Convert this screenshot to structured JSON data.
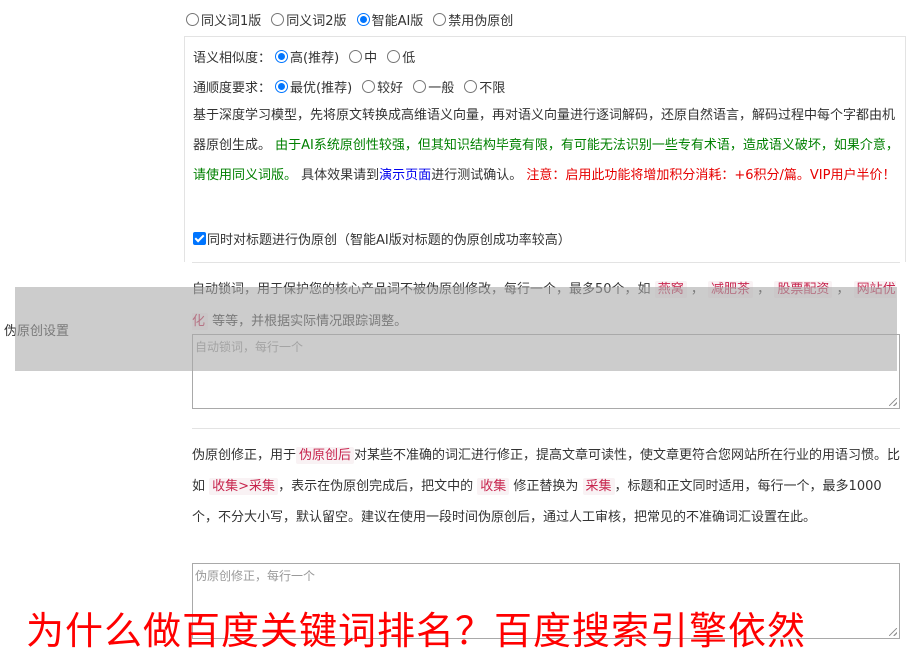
{
  "mode": {
    "options": [
      "同义词1版",
      "同义词2版",
      "智能AI版",
      "禁用伪原创"
    ],
    "selected": 2
  },
  "similarity": {
    "label": "语义相似度：",
    "options": [
      "高(推荐)",
      "中",
      "低"
    ]
  },
  "fluency": {
    "label": "通顺度要求：",
    "options": [
      "最优(推荐)",
      "较好",
      "一般",
      "不限"
    ]
  },
  "description": {
    "part1": "基于深度学习模型，先将原文转换成高维语义向量，再对语义向量进行逐词解码，还原自然语言，解码过程中每个字都由机器原创生成。",
    "part2_green": "由于AI系统原创性较强，但其知识结构毕竟有限，有可能无法识别一些专有术语，造成语义破坏，如果介意，请使用同义词版。",
    "part3_pre": "具体效果请到",
    "demo_link": "演示页面",
    "part3_post": "进行测试确认。",
    "part4_red": "注意：启用此功能将增加积分消耗：+6积分/篇。VIP用户半价！"
  },
  "title_checkbox": {
    "label": "同时对标题进行伪原创（智能AI版对标题的伪原创成功率较高）"
  },
  "lock_words": {
    "intro": "自动锁词，用于保护您的核心产品词不被伪原创修改，每行一个，最多50个，如",
    "examples": [
      "燕窝",
      "减肥茶",
      "股票配资",
      "网站优化"
    ],
    "sep": "，",
    "outro": "等等，并根据实际情况跟踪调整。",
    "placeholder": "自动锁词，每行一个"
  },
  "side_label": "伪原创设置",
  "correction": {
    "t1": "伪原创修正，用于",
    "tag1": "伪原创后",
    "t2": "对某些不准确的词汇进行修正，提高文章可读性，使文章更符合您网站所在行业的用语习惯。比如",
    "tag2": "收集>采集",
    "t3": "，表示在伪原创完成后，把文中的",
    "tag3": "收集",
    "t4": "修正替换为",
    "tag4": "采集",
    "t5": "，标题和正文同时适用，每行一个，最多1000个，不分大小写，默认留空。建议在使用一段时间伪原创后，通过人工审核，把常见的不准确词汇设置在此。",
    "placeholder": "伪原创修正，每行一个"
  },
  "banner": "为什么做百度关键词排名？百度搜索引擎依然"
}
